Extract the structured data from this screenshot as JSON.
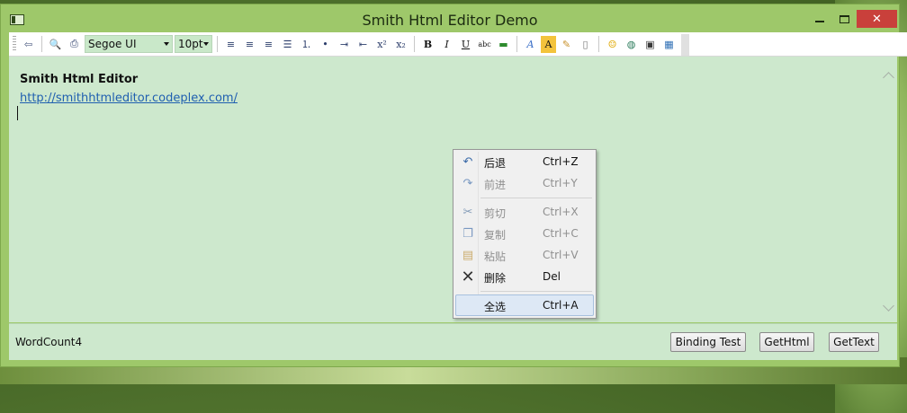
{
  "window": {
    "title": "Smith Html Editor Demo"
  },
  "toolbar": {
    "font_name": "Segoe UI",
    "font_size": "10pt",
    "icons": [
      "preview-icon",
      "print-preview-icon",
      "print-icon",
      "align-left-icon",
      "align-center-icon",
      "align-right-icon",
      "justify-icon",
      "numbered-list-icon",
      "bullet-list-icon",
      "indent-icon",
      "outdent-icon",
      "superscript-icon",
      "subscript-icon",
      "bold-icon",
      "italic-icon",
      "underline-icon",
      "strikethrough-icon",
      "highlight-icon",
      "font-color-icon",
      "background-color-icon",
      "clear-format-icon",
      "document-icon",
      "emoticon-icon",
      "hyperlink-icon",
      "image-icon",
      "table-icon"
    ]
  },
  "editor": {
    "heading": "Smith Html Editor",
    "link": "http://smithhtmleditor.codeplex.com/"
  },
  "context_menu": {
    "items": [
      {
        "label": "后退",
        "shortcut": "Ctrl+Z",
        "icon": "undo-icon",
        "enabled": true
      },
      {
        "label": "前进",
        "shortcut": "Ctrl+Y",
        "icon": "redo-icon",
        "enabled": false
      },
      {
        "label": "剪切",
        "shortcut": "Ctrl+X",
        "icon": "cut-icon",
        "enabled": false
      },
      {
        "label": "复制",
        "shortcut": "Ctrl+C",
        "icon": "copy-icon",
        "enabled": false
      },
      {
        "label": "粘贴",
        "shortcut": "Ctrl+V",
        "icon": "paste-icon",
        "enabled": false
      },
      {
        "label": "删除",
        "shortcut": "Del",
        "icon": "delete-icon",
        "enabled": true
      },
      {
        "label": "全选",
        "shortcut": "Ctrl+A",
        "icon": "",
        "enabled": true
      }
    ]
  },
  "footer": {
    "word_count": "WordCount4",
    "binding_test": "Binding Test",
    "get_html": "GetHtml",
    "get_text": "GetText"
  },
  "colors": {
    "title_bar": "#9ec86a",
    "editor_bg": "#cde8cd",
    "close_button": "#c9403b",
    "link": "#1f5fb0"
  }
}
